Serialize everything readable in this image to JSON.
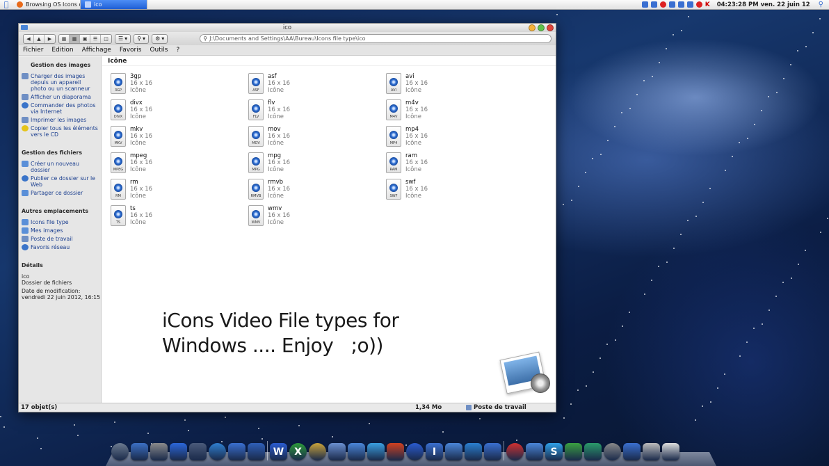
{
  "topbar": {
    "tasks": [
      {
        "label": "Browsing OS Icons o...",
        "active": false
      },
      {
        "label": "ico",
        "active": true
      }
    ],
    "clock": "04:23:28 PM ven. 22 juin 12"
  },
  "window": {
    "title": "ico",
    "address": "J:\\Documents and Settings\\AA\\Bureau\\Icons file type\\ico",
    "menu": [
      "Fichier",
      "Edition",
      "Affichage",
      "Favoris",
      "Outils",
      "?"
    ],
    "column_header": "Icône"
  },
  "sidebar": {
    "image_tasks": {
      "title": "Gestion des images",
      "items": [
        "Charger des images depuis un appareil photo ou un scanneur",
        "Afficher un diaporama",
        "Commander des photos via Internet",
        "Imprimer les images",
        "Copier tous les éléments vers le CD"
      ]
    },
    "file_tasks": {
      "title": "Gestion des fichiers",
      "items": [
        "Créer un nouveau dossier",
        "Publier ce dossier sur le Web",
        "Partager ce dossier"
      ]
    },
    "other_places": {
      "title": "Autres emplacements",
      "items": [
        "Icons file type",
        "Mes images",
        "Poste de travail",
        "Favoris réseau"
      ]
    },
    "details": {
      "title": "Détails",
      "name": "ico",
      "type": "Dossier de fichiers",
      "modified": "Date de modification: vendredi 22 juin 2012, 16:15"
    }
  },
  "files": [
    {
      "name": "3gp",
      "ext": "3GP",
      "size": "16 x 16",
      "type": "Icône"
    },
    {
      "name": "asf",
      "ext": "ASF",
      "size": "16 x 16",
      "type": "Icône"
    },
    {
      "name": "avi",
      "ext": "AVI",
      "size": "16 x 16",
      "type": "Icône"
    },
    {
      "name": "divx",
      "ext": "DIVX",
      "size": "16 x 16",
      "type": "Icône"
    },
    {
      "name": "flv",
      "ext": "FLV",
      "size": "16 x 16",
      "type": "Icône"
    },
    {
      "name": "m4v",
      "ext": "M4V",
      "size": "16 x 16",
      "type": "Icône"
    },
    {
      "name": "mkv",
      "ext": "MKV",
      "size": "16 x 16",
      "type": "Icône"
    },
    {
      "name": "mov",
      "ext": "MOV",
      "size": "16 x 16",
      "type": "Icône"
    },
    {
      "name": "mp4",
      "ext": "MP4",
      "size": "16 x 16",
      "type": "Icône"
    },
    {
      "name": "mpeg",
      "ext": "MPEG",
      "size": "16 x 16",
      "type": "Icône"
    },
    {
      "name": "mpg",
      "ext": "MPG",
      "size": "16 x 16",
      "type": "Icône"
    },
    {
      "name": "ram",
      "ext": "RAM",
      "size": "16 x 16",
      "type": "Icône"
    },
    {
      "name": "rm",
      "ext": "RM",
      "size": "16 x 16",
      "type": "Icône"
    },
    {
      "name": "rmvb",
      "ext": "RMVB",
      "size": "16 x 16",
      "type": "Icône"
    },
    {
      "name": "swf",
      "ext": "SWF",
      "size": "16 x 16",
      "type": "Icône"
    },
    {
      "name": "ts",
      "ext": "TS",
      "size": "16 x 16",
      "type": "Icône"
    },
    {
      "name": "wmv",
      "ext": "WMV",
      "size": "16 x 16",
      "type": "Icône"
    }
  ],
  "overlay": {
    "line1": "iCons Video File types for",
    "line2": "Windows .... Enjoy   ;o))"
  },
  "status": {
    "count": "17 objet(s)",
    "size": "1,34 Mo",
    "location": "Poste de travail"
  },
  "dock": {
    "colors": [
      "#6b7a8f",
      "#3b6fc4",
      "#8a8a8a",
      "#2b66d9",
      "#4a5a7a",
      "#2f7fd0",
      "#3a6fd0",
      "#2f5fb8",
      "#2a5bd0",
      "#2d9a3a",
      "#c9a33a",
      "#6a8fd0",
      "#4a86d8",
      "#3a9fe0",
      "#d04020",
      "#2a5bd0",
      "#3a6fd0",
      "#4a86d8",
      "#2a7fd0",
      "#3a6fd0",
      "#d03030",
      "#4a86d8",
      "#2fa0e8",
      "#3aa040",
      "#2a9a6a",
      "#888888",
      "#3a6fd0",
      "#bbbbbb",
      "#dddddd"
    ],
    "letters": [
      "",
      "",
      "",
      "",
      "",
      "",
      "",
      "",
      "W",
      "X",
      "",
      "",
      "",
      "",
      "",
      "",
      "I",
      "",
      "",
      "",
      "",
      "",
      "S",
      "",
      "",
      "",
      "",
      "",
      ""
    ]
  }
}
